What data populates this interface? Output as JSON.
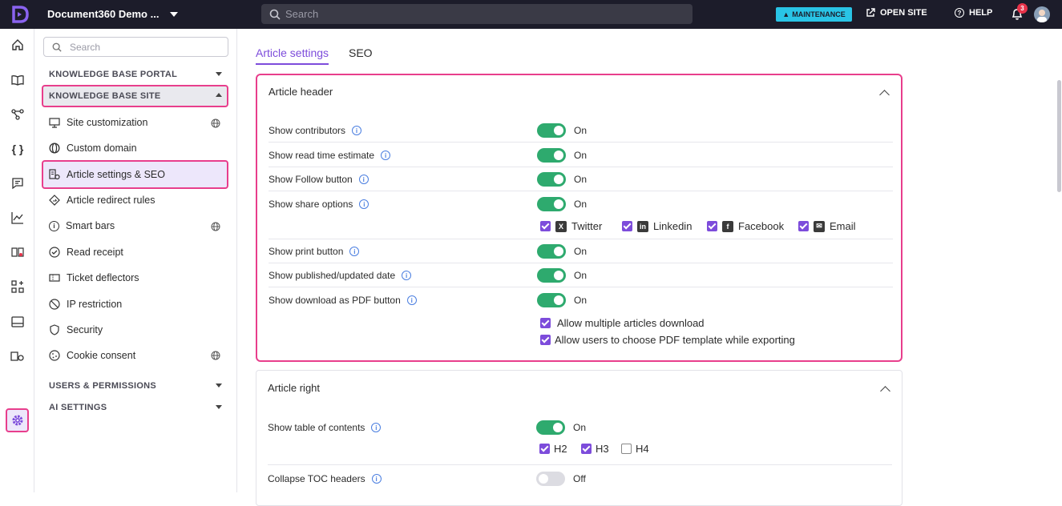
{
  "topbar": {
    "project_name": "Document360 Demo ...",
    "search_placeholder": "Search",
    "maintenance_label": "MAINTENANCE",
    "open_site_label": "OPEN SITE",
    "help_label": "HELP",
    "notification_count": "3"
  },
  "sidebar": {
    "search_placeholder": "Search",
    "sections": {
      "portal": "KNOWLEDGE BASE PORTAL",
      "site": "KNOWLEDGE BASE SITE",
      "users": "USERS & PERMISSIONS",
      "ai": "AI SETTINGS"
    },
    "items": [
      {
        "label": "Site customization",
        "icon": "monitor-icon"
      },
      {
        "label": "Custom domain",
        "icon": "globe-icon"
      },
      {
        "label": "Article settings & SEO",
        "icon": "article-settings-icon"
      },
      {
        "label": "Article redirect rules",
        "icon": "redirect-icon"
      },
      {
        "label": "Smart bars",
        "icon": "info-icon"
      },
      {
        "label": "Read receipt",
        "icon": "check-circle-icon"
      },
      {
        "label": "Ticket deflectors",
        "icon": "ticket-icon"
      },
      {
        "label": "IP restriction",
        "icon": "block-icon"
      },
      {
        "label": "Security",
        "icon": "shield-icon"
      },
      {
        "label": "Cookie consent",
        "icon": "cookie-icon"
      }
    ]
  },
  "tabs": {
    "article_settings": "Article settings",
    "seo": "SEO"
  },
  "article_header": {
    "title": "Article header",
    "rows": [
      {
        "label": "Show contributors",
        "state": "On"
      },
      {
        "label": "Show read time estimate",
        "state": "On"
      },
      {
        "label": "Show Follow button",
        "state": "On"
      },
      {
        "label": "Show share options",
        "state": "On"
      },
      {
        "label": "Show print button",
        "state": "On"
      },
      {
        "label": "Show published/updated date",
        "state": "On"
      },
      {
        "label": "Show download as PDF button",
        "state": "On"
      }
    ],
    "share": {
      "twitter": "Twitter",
      "linkedin": "Linkedin",
      "facebook": "Facebook",
      "email": "Email"
    },
    "pdf": {
      "multiple": "Allow multiple articles download",
      "template": "Allow users to choose PDF template while exporting"
    }
  },
  "article_right": {
    "title": "Article right",
    "toc_label": "Show table of contents",
    "toc_state": "On",
    "h2": "H2",
    "h3": "H3",
    "h4": "H4",
    "collapse_label": "Collapse TOC headers",
    "collapse_state": "Off"
  },
  "colors": {
    "accent": "#7d4cdb",
    "highlight": "#e83e8c",
    "toggle_on": "#2eaa6e"
  }
}
